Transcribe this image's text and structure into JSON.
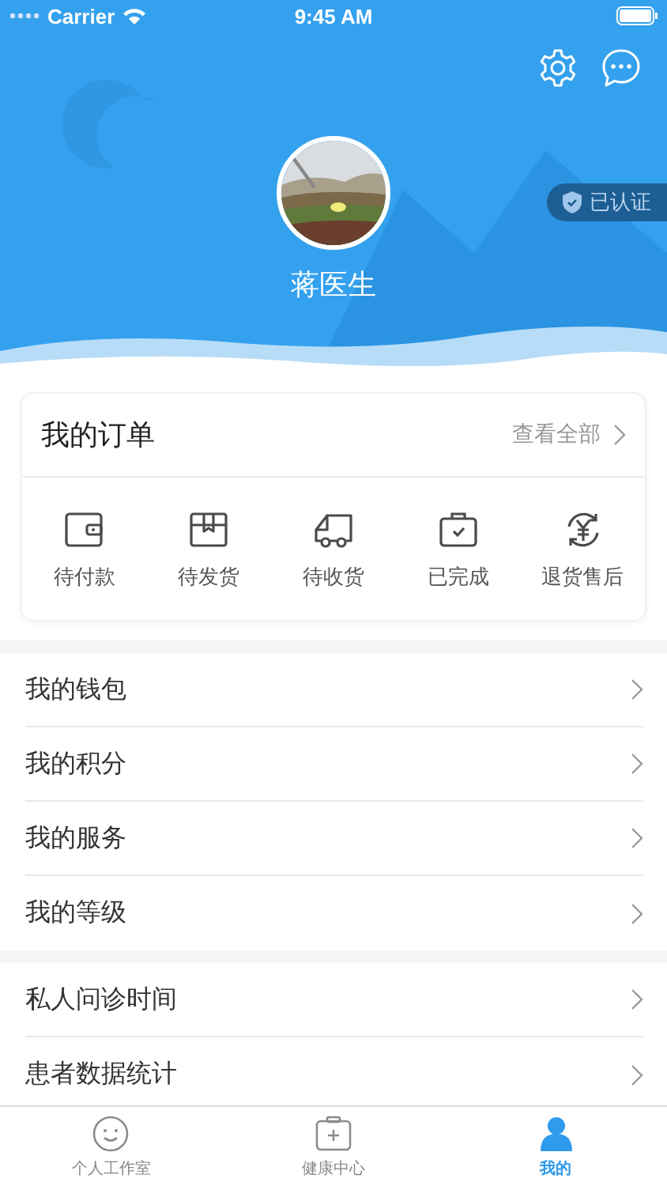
{
  "status_bar": {
    "carrier": "Carrier",
    "time": "9:45 AM"
  },
  "profile": {
    "name": "蒋医生",
    "badge": "已认证"
  },
  "orders": {
    "title": "我的订单",
    "view_all": "查看全部",
    "items": [
      {
        "kind": "wallet",
        "label": "待付款"
      },
      {
        "kind": "box",
        "label": "待发货"
      },
      {
        "kind": "truck",
        "label": "待收货"
      },
      {
        "kind": "done",
        "label": "已完成"
      },
      {
        "kind": "refund",
        "label": "退货售后"
      }
    ]
  },
  "menu_groups": [
    {
      "items": [
        {
          "label": "我的钱包"
        },
        {
          "label": "我的积分"
        },
        {
          "label": "我的服务"
        },
        {
          "label": "我的等级"
        }
      ]
    },
    {
      "items": [
        {
          "label": "私人问诊时间"
        },
        {
          "label": "患者数据统计"
        }
      ]
    }
  ],
  "tabs": [
    {
      "kind": "studio",
      "label": "个人工作室",
      "selected": false
    },
    {
      "kind": "health",
      "label": "健康中心",
      "selected": false
    },
    {
      "kind": "me",
      "label": "我的",
      "selected": true
    }
  ]
}
